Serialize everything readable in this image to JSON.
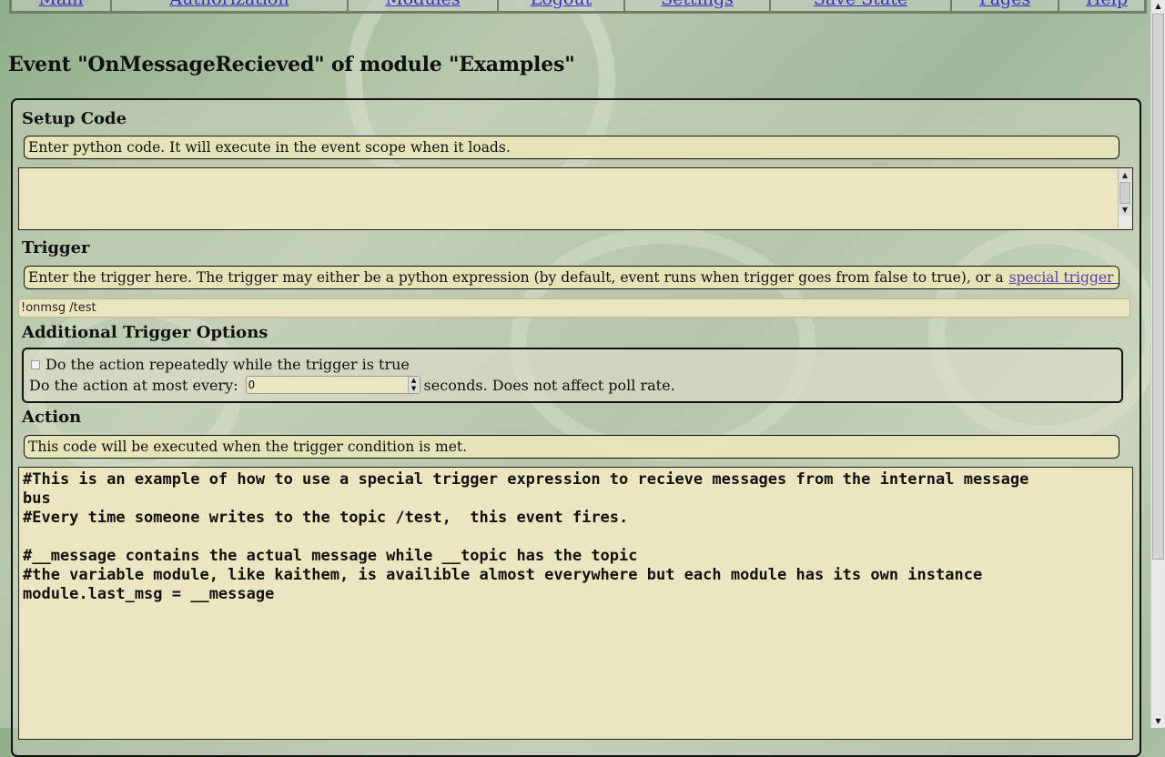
{
  "nav": {
    "items": [
      {
        "label": "Main",
        "width": 108
      },
      {
        "label": "Authorization",
        "width": 258
      },
      {
        "label": "Modules",
        "width": 163
      },
      {
        "label": "Logout",
        "width": 137
      },
      {
        "label": "Settings",
        "width": 158
      },
      {
        "label": "Save State",
        "width": 197
      },
      {
        "label": "Pages",
        "width": 116
      },
      {
        "label": "Help",
        "width": 104
      }
    ]
  },
  "page": {
    "title": "Event \"OnMessageRecieved\" of module \"Examples\""
  },
  "setup": {
    "heading": "Setup Code",
    "help": "Enter python code. It will execute in the event scope when it loads.",
    "code": ""
  },
  "trigger": {
    "heading": "Trigger",
    "help": "Enter the trigger here. The trigger may either be a python expression (by default, event runs when trigger goes from false to true), or a",
    "help_link": "special trigger expression",
    "value": "!onmsg /test"
  },
  "options": {
    "heading": "Additional Trigger Options",
    "repeat_label": "Do the action repeatedly while the trigger is true",
    "repeat_checked": false,
    "every_label": "Do the action at most every:",
    "every_value": "0",
    "every_suffix": "seconds. Does not affect poll rate."
  },
  "action": {
    "heading": "Action",
    "help": "This code will be executed when the trigger condition is met.",
    "lines": [
      "#This is an example of how to use a special trigger expression to recieve messages from the internal message",
      "bus",
      "#Every time someone writes to the topic /test,  this event fires.",
      "",
      "#__message contains the actual message while __topic has the topic",
      "#the variable module, like kaithem, is availible almost everywhere but each module has its own instance",
      "module.last_msg = __message"
    ]
  },
  "colors": {
    "link": "#3b2bd0",
    "visited_link": "#5a3aa6",
    "field_bg": "#ebe6c0"
  },
  "icons": {
    "scroll_up": "triangle-up-icon",
    "scroll_down": "triangle-down-icon",
    "cursor": "arrow-cursor-icon"
  }
}
